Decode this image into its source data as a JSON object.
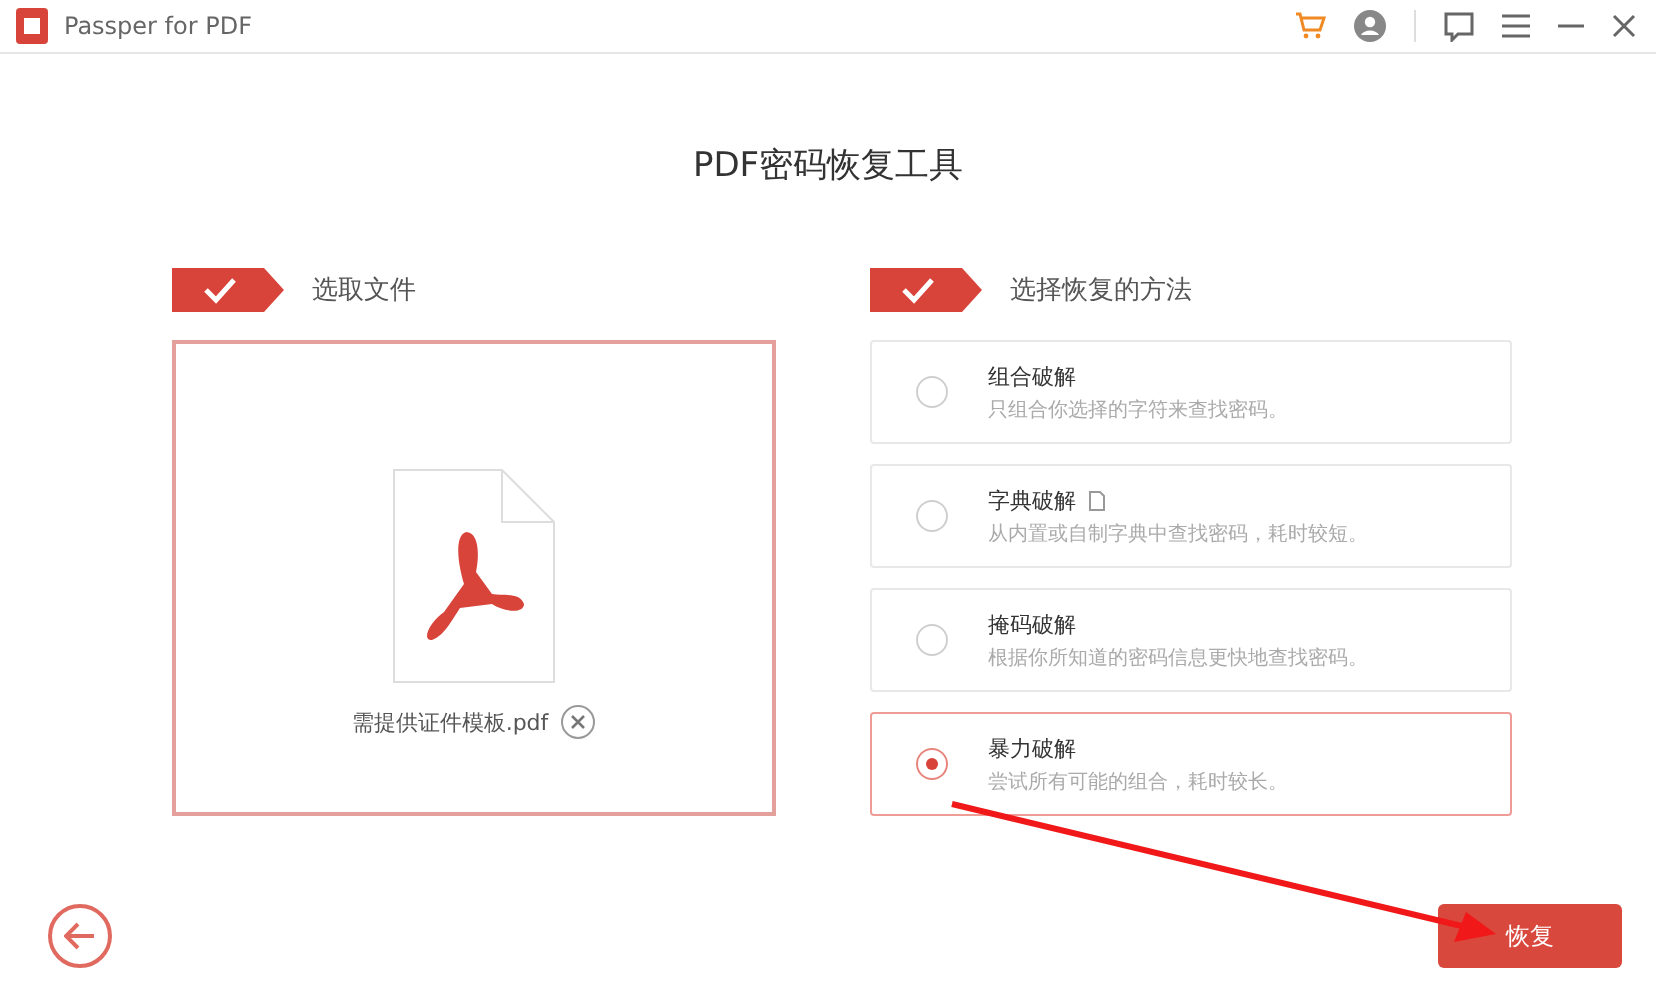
{
  "window": {
    "title": "Passper for PDF"
  },
  "heading": "PDF密码恢复工具",
  "file_step": {
    "label": "选取文件",
    "done": true,
    "file_name": "需提供证件模板.pdf"
  },
  "method_step": {
    "label": "选择恢复的方法",
    "done": true
  },
  "methods": [
    {
      "name": "组合破解",
      "description": "只组合你选择的字符来查找密码。",
      "selected": false,
      "note_icon": false
    },
    {
      "name": "字典破解",
      "description": "从内置或自制字典中查找密码，耗时较短。",
      "selected": false,
      "note_icon": true
    },
    {
      "name": "掩码破解",
      "description": "根据你所知道的密码信息更快地查找密码。",
      "selected": false,
      "note_icon": false
    },
    {
      "name": "暴力破解",
      "description": "尝试所有可能的组合，耗时较长。",
      "selected": true,
      "note_icon": false
    }
  ],
  "recover_button": "恢复"
}
